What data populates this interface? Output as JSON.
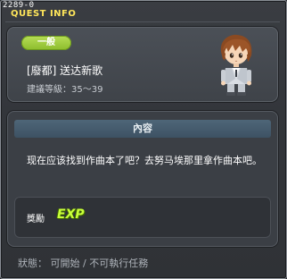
{
  "window": {
    "id": "2289-0",
    "title": "QUEST INFO"
  },
  "quest": {
    "category": "一般",
    "name": "[廢都] 送达新歌",
    "level_requirement": "建議等級：35～39"
  },
  "content": {
    "header": "內容",
    "text": "现在应该找到作曲本了吧？去努马埃那里拿作曲本吧。"
  },
  "reward": {
    "label": "獎勵",
    "icon_text": "EXP"
  },
  "status": {
    "text": "狀態： 可開始 / 不可執行任務"
  },
  "colors": {
    "title_accent": "#ffe65a",
    "badge_green": "#a3cd42",
    "exp_green": "#c9ff3a"
  }
}
